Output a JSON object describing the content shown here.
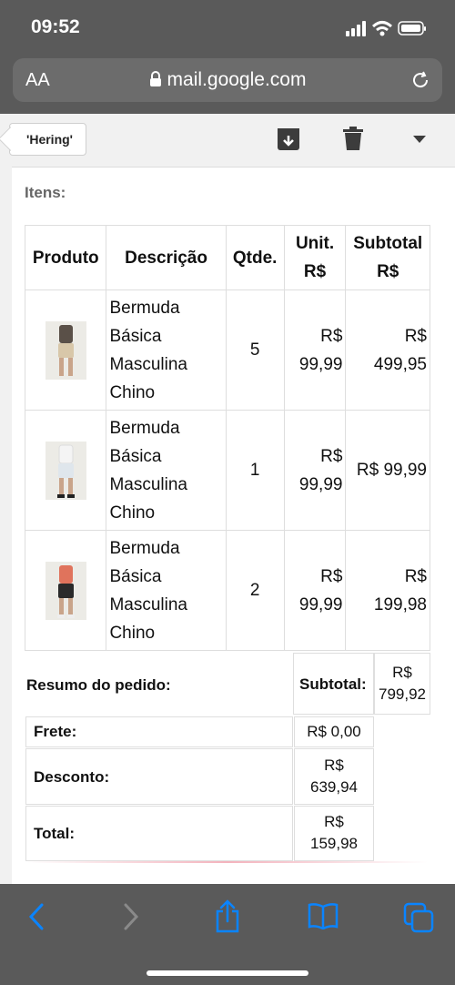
{
  "status": {
    "time": "09:52"
  },
  "browser": {
    "aa_label": "AA",
    "url": "mail.google.com"
  },
  "mail_toolbar": {
    "back_label": "'Hering'"
  },
  "email": {
    "section_label": "Itens:",
    "table": {
      "headers": {
        "product": "Produto",
        "description": "Descrição",
        "qty": "Qtde.",
        "unit": "Unit. R$",
        "subtotal": "Subtotal R$"
      },
      "rows": [
        {
          "description": "Bermuda Básica Masculina Chino",
          "qty": "5",
          "unit": "R$ 99,99",
          "subtotal": "R$ 499,95"
        },
        {
          "description": "Bermuda Básica Masculina Chino",
          "qty": "1",
          "unit": "R$ 99,99",
          "subtotal": "R$ 99,99"
        },
        {
          "description": "Bermuda Básica Masculina Chino",
          "qty": "2",
          "unit": "R$ 99,99",
          "subtotal": "R$ 199,98"
        }
      ]
    },
    "summary": {
      "title": "Resumo do pedido:",
      "subtotal_label": "Subtotal:",
      "subtotal_value": "R$ 799,92",
      "freight_label": "Frete:",
      "freight_value": "R$ 0,00",
      "discount_label": "Desconto:",
      "discount_value": "R$ 639,94",
      "total_label": "Total:",
      "total_value": "R$ 159,98"
    }
  },
  "colors": {
    "chrome": "#5a5a5a",
    "accent": "#0a84ff",
    "toolbar": "#f1f1f1"
  }
}
